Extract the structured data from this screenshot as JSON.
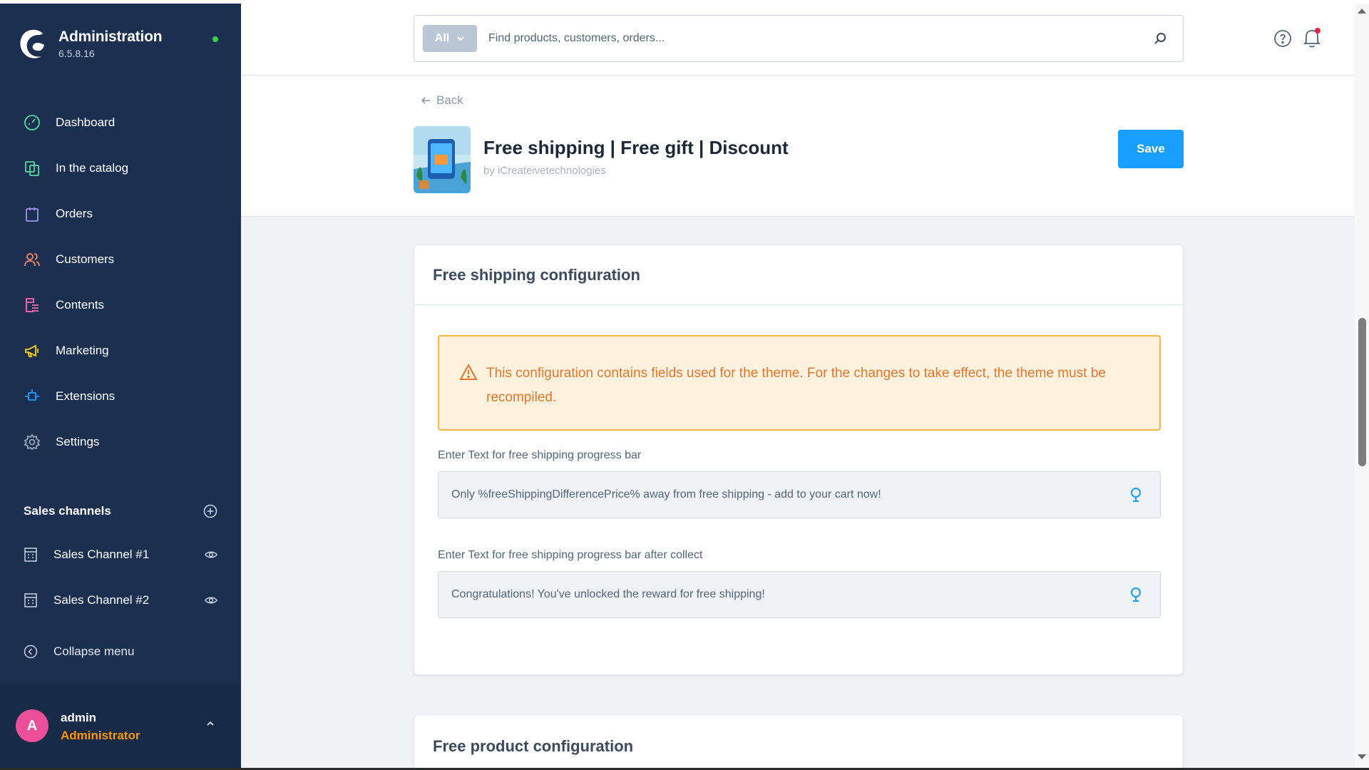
{
  "app": {
    "name": "Administration",
    "version": "6.5.8.16"
  },
  "sidebar": {
    "items": [
      {
        "label": "Dashboard",
        "icon": "dashboard-icon",
        "color": "#57d9a3"
      },
      {
        "label": "In the catalog",
        "icon": "catalog-icon",
        "color": "#57d9a3"
      },
      {
        "label": "Orders",
        "icon": "orders-icon",
        "color": "#a092f0"
      },
      {
        "label": "Customers",
        "icon": "customers-icon",
        "color": "#f88962"
      },
      {
        "label": "Contents",
        "icon": "contents-icon",
        "color": "#ff68b4"
      },
      {
        "label": "Marketing",
        "icon": "marketing-icon",
        "color": "#ffd700"
      },
      {
        "label": "Extensions",
        "icon": "extensions-icon",
        "color": "#189eff"
      },
      {
        "label": "Settings",
        "icon": "settings-icon",
        "color": "#9aa8b5"
      }
    ],
    "sales_channels_title": "Sales channels",
    "sales_channels": [
      {
        "label": "Sales Channel #1"
      },
      {
        "label": "Sales Channel #2"
      }
    ],
    "collapse_label": "Collapse menu",
    "user": {
      "initial": "A",
      "name": "admin",
      "role": "Administrator"
    }
  },
  "search": {
    "type_label": "All",
    "placeholder": "Find products, customers, orders..."
  },
  "header": {
    "back_label": "Back",
    "title": "Free shipping | Free gift | Discount",
    "by_line": "by iCreateivetechnologies",
    "save_label": "Save"
  },
  "cards": {
    "free_shipping": {
      "title": "Free shipping configuration",
      "alert": "This configuration contains fields used for the theme. For the changes to take effect, the theme must be recompiled.",
      "fields": [
        {
          "label": "Enter Text for free shipping progress bar",
          "value": "Only %freeShippingDifferencePrice% away from free shipping - add to your cart now!"
        },
        {
          "label": "Enter Text for free shipping progress bar after collect",
          "value": "Congratulations! You've unlocked the reward for free shipping!"
        }
      ]
    },
    "free_product": {
      "title": "Free product configuration"
    }
  },
  "colors": {
    "sidebar_bg": "#1b2f50",
    "primary": "#189eff",
    "alert_bg": "#fff2de",
    "alert_border": "#ffb340",
    "alert_text": "#e5752a"
  }
}
